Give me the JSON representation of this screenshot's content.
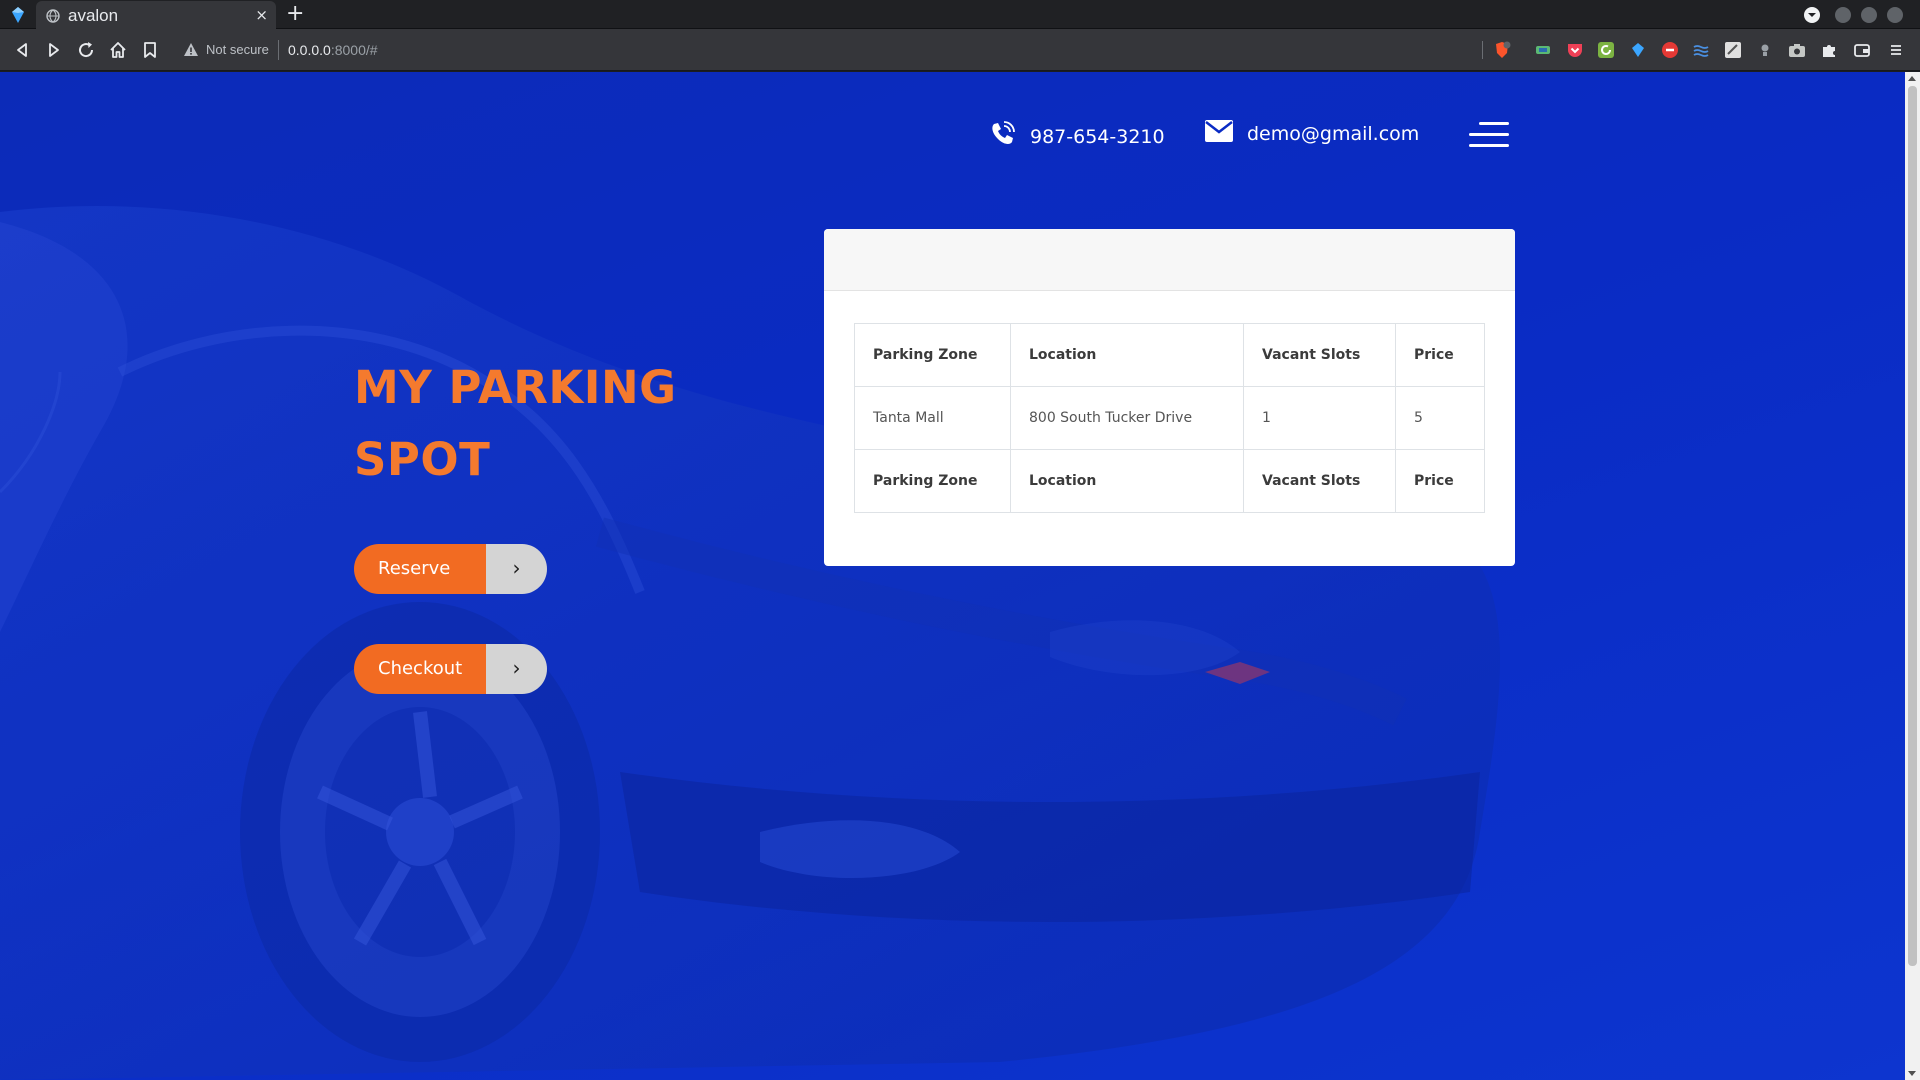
{
  "browser": {
    "tab_title": "avalon",
    "tab_close": "×",
    "new_tab": "+",
    "security_label": "Not secure",
    "url_host": "0.0.0.0",
    "url_rest": ":8000/#"
  },
  "header": {
    "phone": "987-654-3210",
    "email": "demo@gmail.com"
  },
  "hero": {
    "title": "MY PARKING SPOT",
    "buttons": [
      {
        "label": "Reserve",
        "arrow": "›"
      },
      {
        "label": "Checkout",
        "arrow": "›"
      }
    ]
  },
  "table": {
    "headers": [
      "Parking Zone",
      "Location",
      "Vacant Slots",
      "Price"
    ],
    "rows": [
      [
        "Tanta Mall",
        "800 South Tucker Drive",
        "1",
        "5"
      ]
    ],
    "footers": [
      "Parking Zone",
      "Location",
      "Vacant Slots",
      "Price"
    ]
  },
  "colors": {
    "page_background": "#0a2bc4",
    "accent_orange": "#f26b22",
    "title_orange": "#f47a2e"
  }
}
